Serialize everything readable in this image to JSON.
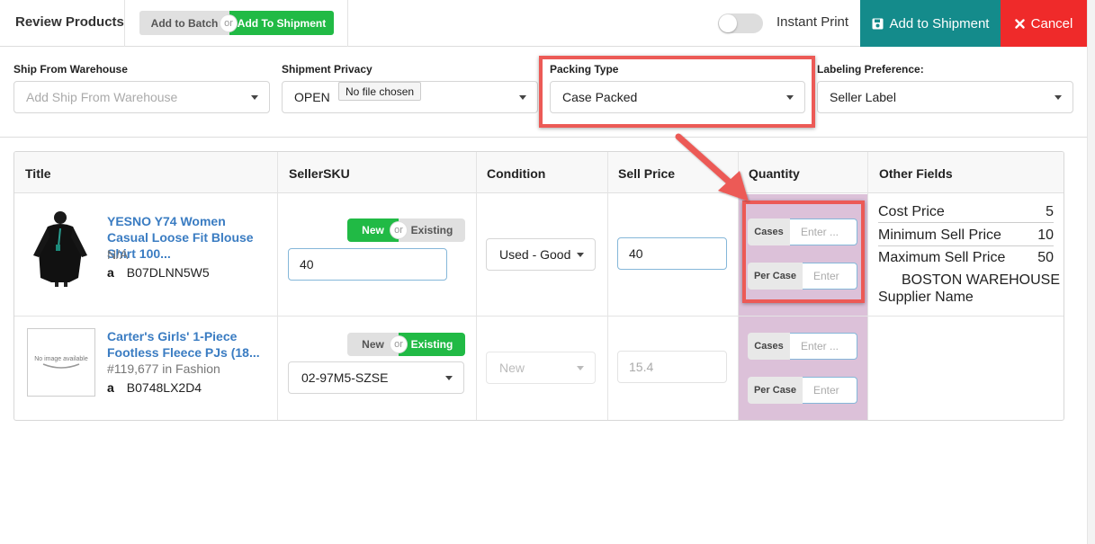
{
  "header": {
    "title": "Review Products",
    "mode_toggle": {
      "left_label": "Add to Batch",
      "or_label": "or",
      "right_label": "Add To Shipment",
      "active": "Add To Shipment"
    },
    "instant_print_label": "Instant Print",
    "instant_print_on": false,
    "add_to_shipment_label": "Add to Shipment",
    "cancel_label": "Cancel"
  },
  "form": {
    "ship_from": {
      "label": "Ship From Warehouse",
      "placeholder": "Add Ship From Warehouse"
    },
    "privacy": {
      "label": "Shipment Privacy",
      "value": "OPEN",
      "tooltip": "No file chosen"
    },
    "packing": {
      "label": "Packing Type",
      "value": "Case Packed"
    },
    "labeling": {
      "label": "Labeling Preference:",
      "value": "Seller Label"
    }
  },
  "table": {
    "columns": [
      "Title",
      "SellerSKU",
      "Condition",
      "Sell Price",
      "Quantity",
      "Other Fields"
    ],
    "rows": [
      {
        "title": "YESNO Y74 Women Casual Loose Fit Blouse Shirt 100...",
        "subtitle": "N/A",
        "asin": "B07DLNN5W5",
        "sku_toggle": {
          "new": "New",
          "or": "or",
          "existing": "Existing",
          "active": "New"
        },
        "sku_value": "40",
        "condition": "Used - Good",
        "sell_price": "40",
        "qty": {
          "cases_label": "Cases",
          "cases_placeholder": "Enter ...",
          "per_case_label": "Per Case",
          "per_case_placeholder": "Enter"
        },
        "other_fields": {
          "cost_label": "Cost Price",
          "cost_value": "5",
          "min_label": "Minimum Sell Price",
          "min_value": "10",
          "max_label": "Maximum Sell Price",
          "max_value": "50",
          "supplier_value": "BOSTON WAREHOUSE",
          "supplier_label": "Supplier Name"
        }
      },
      {
        "title": "Carter's Girls' 1-Piece Footless Fleece PJs (18...",
        "subtitle": "#119,677 in Fashion",
        "asin": "B0748LX2D4",
        "image_placeholder": "No image available",
        "sku_toggle": {
          "new": "New",
          "or": "or",
          "existing": "Existing",
          "active": "Existing"
        },
        "sku_value": "02-97M5-SZSE",
        "condition": "New",
        "sell_price": "15.4",
        "qty": {
          "cases_label": "Cases",
          "cases_placeholder": "Enter ...",
          "per_case_label": "Per Case",
          "per_case_placeholder": "Enter"
        }
      }
    ]
  },
  "colors": {
    "accent_green": "#21ba45",
    "teal": "#148b8b",
    "red": "#ef2a2a",
    "highlight": "#ec5a56",
    "quantity_bg": "#dcc1d9",
    "link_blue": "#3a7cc2"
  },
  "icons": [
    "save-icon",
    "close-icon",
    "amazon-icon",
    "chevron-down-icon",
    "arrow-annotation"
  ]
}
